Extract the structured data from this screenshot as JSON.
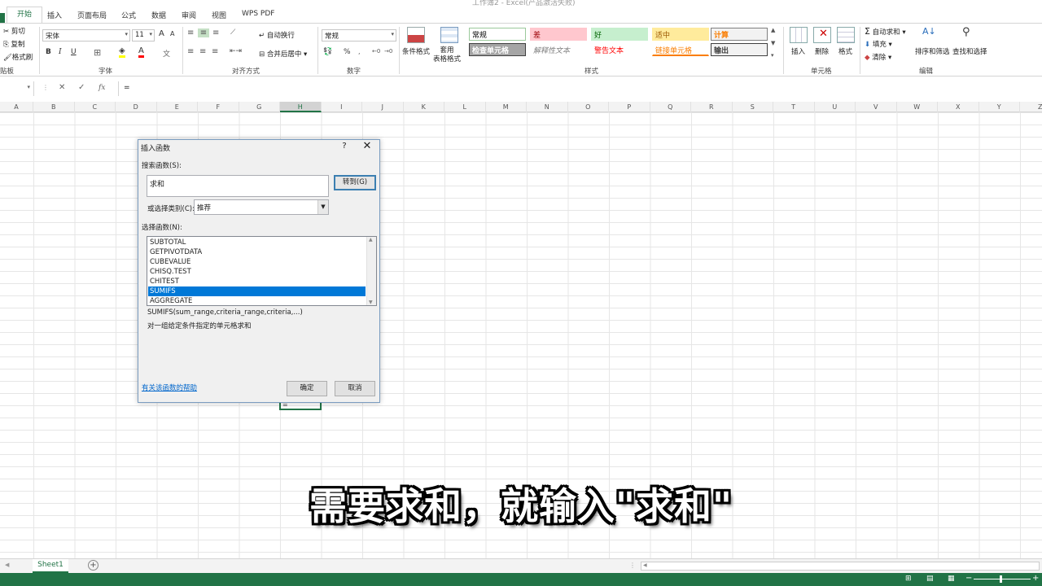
{
  "window": {
    "title": "工作簿2 - Excel(产品激活失败)"
  },
  "ribbon_tabs": [
    "开始",
    "插入",
    "页面布局",
    "公式",
    "数据",
    "审阅",
    "视图",
    "WPS PDF"
  ],
  "clipboard": {
    "cut": "剪切",
    "copy": "复制",
    "format_painter": "格式刷",
    "group": "贴板"
  },
  "font": {
    "name": "宋体",
    "size": "11",
    "bold": "B",
    "italic": "I",
    "underline": "U",
    "grow": "A",
    "shrink": "A",
    "group": "字体"
  },
  "alignment": {
    "wrap": "自动换行",
    "merge": "合并后居中",
    "group": "对齐方式"
  },
  "number": {
    "format": "常规",
    "percent": "%",
    "group": "数字"
  },
  "styles": {
    "conditional": "条件格式",
    "table_format": "套用\n表格格式",
    "cells": [
      {
        "label": "常规",
        "bg": "#ffffff",
        "color": "#000000",
        "border": "#9bc99b"
      },
      {
        "label": "差",
        "bg": "#ffc7ce",
        "color": "#9c0006",
        "border": "#ffc7ce"
      },
      {
        "label": "好",
        "bg": "#c6efce",
        "color": "#006100",
        "border": "#c6efce"
      },
      {
        "label": "适中",
        "bg": "#ffeb9c",
        "color": "#9c5700",
        "border": "#ffeb9c"
      },
      {
        "label": "计算",
        "bg": "#f2f2f2",
        "color": "#fa7d00",
        "border": "#7f7f7f"
      },
      {
        "label": "检查单元格",
        "bg": "#a5a5a5",
        "color": "#ffffff",
        "border": "#3f3f3f"
      },
      {
        "label": "解释性文本",
        "bg": "#ffffff",
        "color": "#7f7f7f",
        "border": "#ffffff"
      },
      {
        "label": "警告文本",
        "bg": "#ffffff",
        "color": "#ff0000",
        "border": "#ffffff"
      },
      {
        "label": "链接单元格",
        "bg": "#ffffff",
        "color": "#fa7d00",
        "border": "#ffffff"
      },
      {
        "label": "输出",
        "bg": "#f2f2f2",
        "color": "#3f3f3f",
        "border": "#3f3f3f"
      }
    ],
    "group": "样式"
  },
  "cells_group": {
    "insert": "插入",
    "delete": "删除",
    "format": "格式",
    "group": "单元格"
  },
  "editing": {
    "autosum": "自动求和",
    "fill": "填充",
    "clear": "清除",
    "sort": "排序和筛选",
    "find": "查找和选择",
    "group": "编辑"
  },
  "formula_bar": {
    "cancel": "✕",
    "enter": "✓",
    "fx": "fx",
    "content": "="
  },
  "columns": [
    "A",
    "B",
    "C",
    "D",
    "E",
    "F",
    "G",
    "H",
    "I",
    "J",
    "K",
    "L",
    "M",
    "N",
    "O",
    "P",
    "Q",
    "R",
    "S",
    "T",
    "U",
    "V",
    "W",
    "X",
    "Y",
    "Z"
  ],
  "selected_column": "H",
  "active_cell_content": "=",
  "dialog": {
    "title": "插入函数",
    "help": "?",
    "close": "✕",
    "search_label": "搜索函数(S):",
    "search_value": "求和",
    "goto": "转到(G)",
    "category_label": "或选择类别(C):",
    "category_value": "推荐",
    "select_label": "选择函数(N):",
    "functions": [
      "SUBTOTAL",
      "GETPIVOTDATA",
      "CUBEVALUE",
      "CHISQ.TEST",
      "CHITEST",
      "SUMIFS",
      "AGGREGATE"
    ],
    "selected_function": "SUMIFS",
    "signature": "SUMIFS(sum_range,criteria_range,criteria,...)",
    "description": "对一组给定条件指定的单元格求和",
    "help_link": "有关该函数的帮助",
    "ok": "确定",
    "cancel": "取消"
  },
  "subtitle": "需要求和，就输入\"求和\"",
  "sheet_tabs": [
    "Sheet1"
  ],
  "add_sheet": "+",
  "accent_color": "#217346"
}
